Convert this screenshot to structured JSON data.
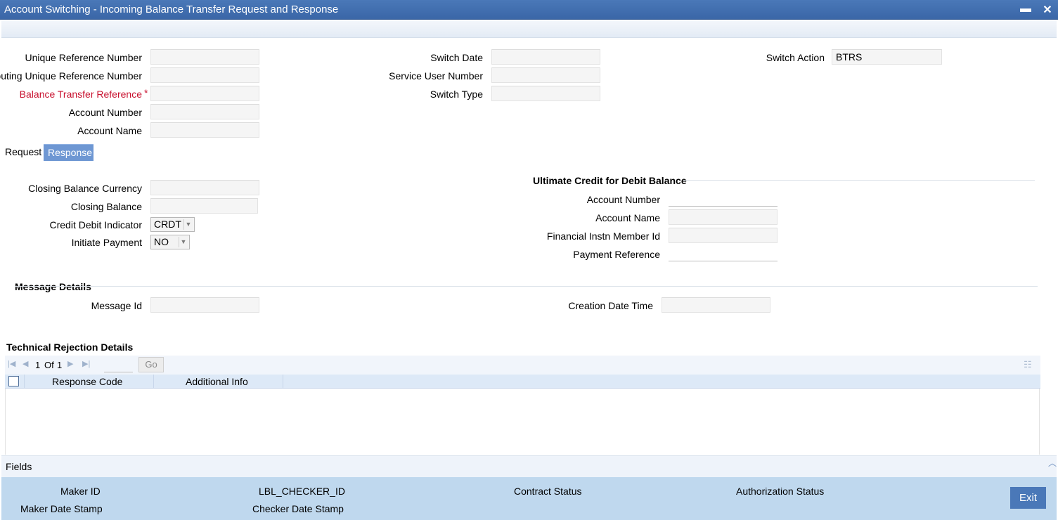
{
  "window": {
    "title": "Account Switching - Incoming Balance Transfer Request and Response",
    "minimize_symbol": "▬",
    "close_symbol": "✕"
  },
  "main": {
    "unique_ref_label": "Unique Reference Number",
    "unique_ref_value": "",
    "routing_ref_label": "Routing Unique Reference Number",
    "routing_ref_value": "",
    "bt_ref_label": "Balance Transfer Reference",
    "bt_ref_required": "*",
    "bt_ref_value": "",
    "account_number_label": "Account Number",
    "account_number_value": "",
    "account_name_label": "Account Name",
    "account_name_value": "",
    "switch_date_label": "Switch Date",
    "switch_date_value": "",
    "service_user_label": "Service User Number",
    "service_user_value": "",
    "switch_type_label": "Switch Type",
    "switch_type_value": "",
    "switch_action_label": "Switch Action",
    "switch_action_value": "BTRS"
  },
  "tabs": [
    {
      "label": "Request",
      "active": false
    },
    {
      "label": "Response",
      "active": true
    }
  ],
  "response": {
    "closing_currency_label": "Closing Balance Currency",
    "closing_currency_value": "",
    "closing_balance_label": "Closing Balance",
    "closing_balance_value": "",
    "credit_debit_label": "Credit Debit Indicator",
    "credit_debit_value": "CRDT",
    "initiate_payment_label": "Initiate Payment",
    "initiate_payment_value": "NO",
    "ultimate_header": "Ultimate Credit for Debit Balance",
    "uc_account_number_label": "Account Number",
    "uc_account_number_value": "",
    "uc_account_name_label": "Account Name",
    "uc_account_name_value": "",
    "uc_fin_member_label": "Financial Instn Member Id",
    "uc_fin_member_value": "",
    "uc_payment_ref_label": "Payment Reference",
    "uc_payment_ref_value": ""
  },
  "message": {
    "header": "Message Details",
    "message_id_label": "Message Id",
    "message_id_value": "",
    "creation_dt_label": "Creation Date Time",
    "creation_dt_value": ""
  },
  "rejection": {
    "header": "Technical Rejection Details",
    "page_current": "1",
    "page_of_label": "Of",
    "page_total": "1",
    "go_label": "Go",
    "columns": [
      "Response Code",
      "Additional Info"
    ],
    "rows": []
  },
  "fields_bar": {
    "label": "Fields"
  },
  "footer": {
    "maker_id_label": "Maker ID",
    "maker_date_label": "Maker Date Stamp",
    "checker_id_label": "LBL_CHECKER_ID",
    "checker_date_label": "Checker Date Stamp",
    "contract_status_label": "Contract Status",
    "auth_status_label": "Authorization Status",
    "exit_label": "Exit"
  }
}
